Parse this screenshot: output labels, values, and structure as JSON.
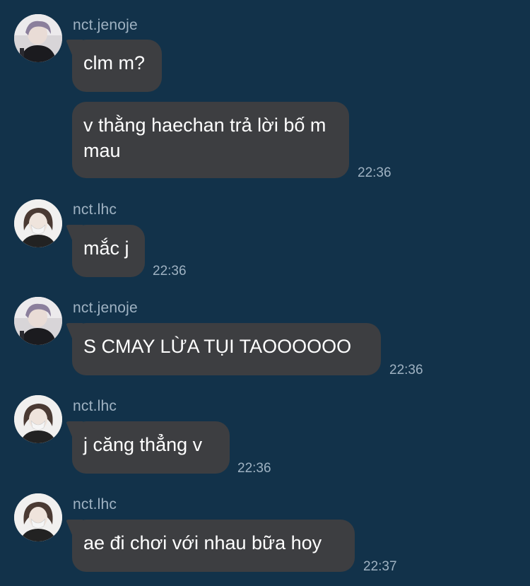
{
  "messages": [
    {
      "user": "nct.jenoje",
      "avatar": "avatar-jenoje",
      "bubbles": [
        {
          "text": "clm m?"
        },
        {
          "text": "v thằng haechan trả lời bố m mau",
          "time": "22:36"
        }
      ]
    },
    {
      "user": "nct.lhc",
      "avatar": "avatar-lhc",
      "bubbles": [
        {
          "text": "mắc j",
          "time": "22:36"
        }
      ]
    },
    {
      "user": "nct.jenoje",
      "avatar": "avatar-jenoje",
      "bubbles": [
        {
          "text": "S CMAY LỪA TỤI TAOOOOOO",
          "time": "22:36"
        }
      ]
    },
    {
      "user": "nct.lhc",
      "avatar": "avatar-lhc",
      "bubbles": [
        {
          "text": "j căng thẳng v",
          "time": "22:36"
        }
      ]
    },
    {
      "user": "nct.lhc",
      "avatar": "avatar-lhc",
      "bubbles": [
        {
          "text": "ae đi chơi với nhau bữa hoy",
          "time": "22:37"
        }
      ]
    }
  ],
  "colors": {
    "background": "#12324a",
    "bubble": "#3d3e41",
    "meta_text": "#9fb2c2"
  }
}
